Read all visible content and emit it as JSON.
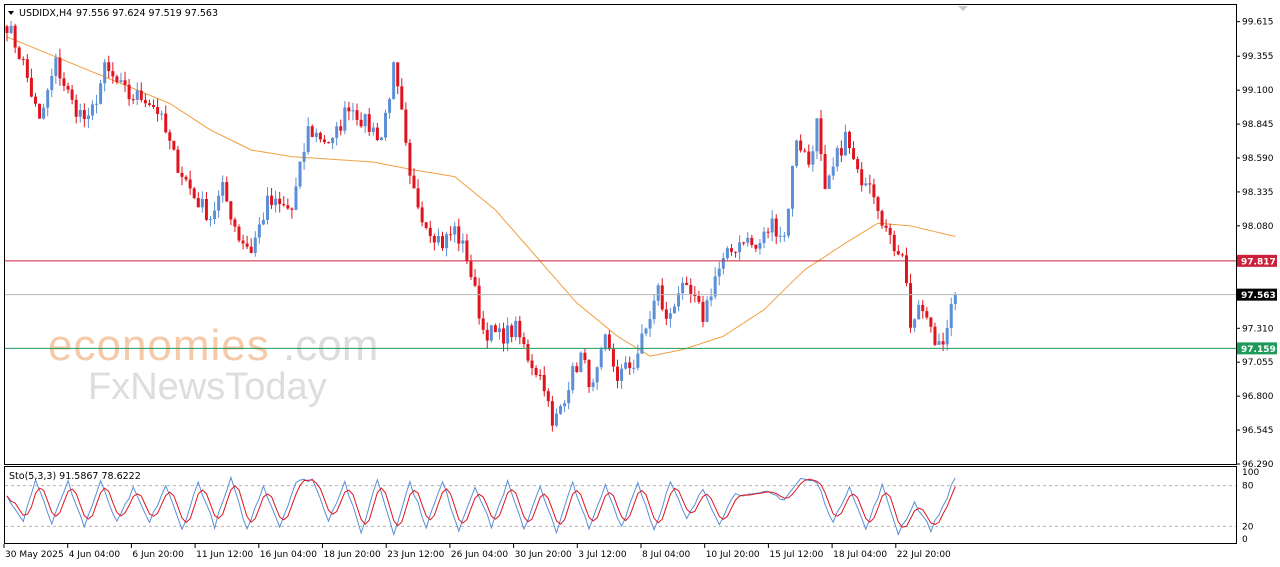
{
  "header": {
    "symbol": "USDIDX,H4",
    "ohlc": "97.556 97.624 97.519 97.563"
  },
  "watermark": {
    "brand_colored": "economies",
    "brand_suffix": ".com",
    "sub_brand": "FxNewsToday"
  },
  "colors": {
    "bull": "#5b8fd6",
    "bear": "#e0141e",
    "ma": "#f0a040",
    "resistance": "#cc1f3a",
    "support": "#1f9a5a",
    "current": "#000000",
    "stoch_main": "#5b8fd6",
    "stoch_signal": "#e0141e"
  },
  "oscillator": {
    "label": "Sto(5,3,3) 91.5867 78.6222",
    "ticks": [
      "100",
      "80",
      "20",
      "0"
    ]
  },
  "chart_data": {
    "type": "candlestick",
    "symbol": "USDIDX",
    "timeframe": "H4",
    "ylim": [
      96.29,
      99.74
    ],
    "y_ticks": [
      "99.615",
      "99.355",
      "99.100",
      "98.845",
      "98.590",
      "98.335",
      "98.080",
      "97.310",
      "97.055",
      "96.800",
      "96.545",
      "96.290"
    ],
    "x_ticks": [
      "30 May 2025",
      "4 Jun 04:00",
      "6 Jun 20:00",
      "11 Jun 12:00",
      "16 Jun 04:00",
      "18 Jun 20:00",
      "23 Jun 12:00",
      "26 Jun 04:00",
      "30 Jun 20:00",
      "3 Jul 12:00",
      "8 Jul 04:00",
      "10 Jul 20:00",
      "15 Jul 12:00",
      "18 Jul 04:00",
      "22 Jul 20:00"
    ],
    "levels": {
      "resistance": {
        "value": 97.817,
        "label": "97.817"
      },
      "current": {
        "value": 97.563,
        "label": "97.563"
      },
      "support": {
        "value": 97.159,
        "label": "97.159"
      }
    },
    "anchors": [
      [
        0,
        99.6
      ],
      [
        4,
        99.3
      ],
      [
        8,
        98.85
      ],
      [
        12,
        99.3
      ],
      [
        16,
        99.0
      ],
      [
        20,
        98.85
      ],
      [
        24,
        99.25
      ],
      [
        30,
        99.05
      ],
      [
        34,
        99.05
      ],
      [
        37,
        98.95
      ],
      [
        41,
        98.6
      ],
      [
        46,
        98.3
      ],
      [
        50,
        98.15
      ],
      [
        53,
        98.35
      ],
      [
        57,
        98.0
      ],
      [
        60,
        97.9
      ],
      [
        64,
        98.25
      ],
      [
        70,
        98.2
      ],
      [
        74,
        98.8
      ],
      [
        80,
        98.7
      ],
      [
        84,
        99.0
      ],
      [
        88,
        98.85
      ],
      [
        92,
        98.75
      ],
      [
        95,
        99.25
      ],
      [
        97,
        98.9
      ],
      [
        99,
        98.4
      ],
      [
        103,
        98.1
      ],
      [
        107,
        97.95
      ],
      [
        110,
        98.05
      ],
      [
        113,
        97.85
      ],
      [
        117,
        97.3
      ],
      [
        121,
        97.25
      ],
      [
        125,
        97.3
      ],
      [
        128,
        97.1
      ],
      [
        132,
        96.9
      ],
      [
        134,
        96.55
      ],
      [
        138,
        96.9
      ],
      [
        141,
        97.1
      ],
      [
        144,
        96.85
      ],
      [
        147,
        97.2
      ],
      [
        150,
        96.95
      ],
      [
        154,
        97.05
      ],
      [
        157,
        97.3
      ],
      [
        160,
        97.6
      ],
      [
        162,
        97.35
      ],
      [
        165,
        97.6
      ],
      [
        168,
        97.55
      ],
      [
        171,
        97.4
      ],
      [
        174,
        97.7
      ],
      [
        177,
        97.85
      ],
      [
        181,
        98.0
      ],
      [
        184,
        97.9
      ],
      [
        188,
        98.1
      ],
      [
        191,
        98.0
      ],
      [
        194,
        98.75
      ],
      [
        197,
        98.55
      ],
      [
        199,
        98.85
      ],
      [
        201,
        98.3
      ],
      [
        204,
        98.6
      ],
      [
        206,
        98.75
      ],
      [
        209,
        98.45
      ],
      [
        212,
        98.45
      ],
      [
        214,
        98.25
      ],
      [
        217,
        97.95
      ],
      [
        220,
        97.9
      ],
      [
        222,
        97.35
      ],
      [
        225,
        97.45
      ],
      [
        228,
        97.2
      ],
      [
        230,
        97.25
      ],
      [
        233,
        97.55
      ]
    ],
    "bar_count": 234,
    "last_close": 97.563,
    "moving_average": {
      "anchors": [
        [
          0,
          99.5
        ],
        [
          20,
          99.25
        ],
        [
          40,
          99.0
        ],
        [
          50,
          98.8
        ],
        [
          60,
          98.65
        ],
        [
          70,
          98.6
        ],
        [
          80,
          98.58
        ],
        [
          90,
          98.56
        ],
        [
          100,
          98.5
        ],
        [
          110,
          98.45
        ],
        [
          120,
          98.2
        ],
        [
          130,
          97.85
        ],
        [
          140,
          97.5
        ],
        [
          150,
          97.25
        ],
        [
          158,
          97.1
        ],
        [
          166,
          97.15
        ],
        [
          176,
          97.25
        ],
        [
          186,
          97.45
        ],
        [
          196,
          97.75
        ],
        [
          206,
          97.95
        ],
        [
          214,
          98.1
        ],
        [
          222,
          98.08
        ],
        [
          233,
          98.0
        ]
      ]
    },
    "stochastic": {
      "anchors": [
        [
          0,
          65
        ],
        [
          4,
          30
        ],
        [
          7,
          90
        ],
        [
          11,
          25
        ],
        [
          15,
          85
        ],
        [
          19,
          20
        ],
        [
          23,
          85
        ],
        [
          27,
          25
        ],
        [
          31,
          75
        ],
        [
          35,
          25
        ],
        [
          39,
          80
        ],
        [
          43,
          15
        ],
        [
          47,
          85
        ],
        [
          51,
          20
        ],
        [
          55,
          90
        ],
        [
          59,
          15
        ],
        [
          63,
          80
        ],
        [
          67,
          20
        ],
        [
          71,
          85
        ],
        [
          75,
          90
        ],
        [
          79,
          30
        ],
        [
          83,
          85
        ],
        [
          87,
          10
        ],
        [
          91,
          90
        ],
        [
          95,
          10
        ],
        [
          99,
          85
        ],
        [
          103,
          20
        ],
        [
          107,
          85
        ],
        [
          111,
          15
        ],
        [
          115,
          80
        ],
        [
          119,
          20
        ],
        [
          123,
          85
        ],
        [
          127,
          15
        ],
        [
          131,
          80
        ],
        [
          135,
          10
        ],
        [
          139,
          85
        ],
        [
          143,
          15
        ],
        [
          147,
          80
        ],
        [
          151,
          20
        ],
        [
          155,
          85
        ],
        [
          159,
          15
        ],
        [
          163,
          85
        ],
        [
          167,
          30
        ],
        [
          171,
          75
        ],
        [
          175,
          25
        ],
        [
          179,
          70
        ],
        [
          183,
          65
        ],
        [
          187,
          70
        ],
        [
          191,
          60
        ],
        [
          195,
          90
        ],
        [
          199,
          85
        ],
        [
          203,
          25
        ],
        [
          207,
          80
        ],
        [
          211,
          15
        ],
        [
          215,
          80
        ],
        [
          219,
          10
        ],
        [
          223,
          55
        ],
        [
          227,
          15
        ],
        [
          230,
          50
        ],
        [
          233,
          92
        ]
      ]
    }
  }
}
